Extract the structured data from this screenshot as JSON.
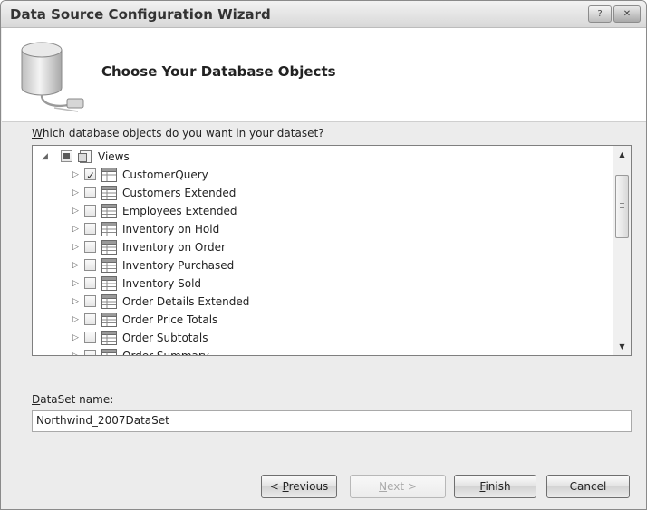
{
  "window": {
    "title": "Data Source Configuration Wizard",
    "minimize_glyph": "?",
    "close_glyph": "✕"
  },
  "header": {
    "title": "Choose Your Database Objects",
    "icon": "database-icon"
  },
  "question": {
    "accesskey": "W",
    "rest": "hich database objects do you want in your dataset?"
  },
  "tree": {
    "root": {
      "label": "Views",
      "expanded": true,
      "state": "partial"
    },
    "items": [
      {
        "label": "CustomerQuery",
        "checked": true
      },
      {
        "label": "Customers Extended",
        "checked": false
      },
      {
        "label": "Employees Extended",
        "checked": false
      },
      {
        "label": "Inventory on Hold",
        "checked": false
      },
      {
        "label": "Inventory on Order",
        "checked": false
      },
      {
        "label": "Inventory Purchased",
        "checked": false
      },
      {
        "label": "Inventory Sold",
        "checked": false
      },
      {
        "label": "Order Details Extended",
        "checked": false
      },
      {
        "label": "Order Price Totals",
        "checked": false
      },
      {
        "label": "Order Subtotals",
        "checked": false
      },
      {
        "label": "Order Summary",
        "checked": false
      }
    ]
  },
  "dataset": {
    "label_accesskey": "D",
    "label_rest": "ataSet name:",
    "value": "Northwind_2007DataSet"
  },
  "buttons": {
    "previous_prefix": "< ",
    "previous_accesskey": "P",
    "previous_rest": "revious",
    "next_accesskey": "N",
    "next_rest": "ext >",
    "finish_accesskey": "F",
    "finish_rest": "inish",
    "cancel": "Cancel"
  }
}
